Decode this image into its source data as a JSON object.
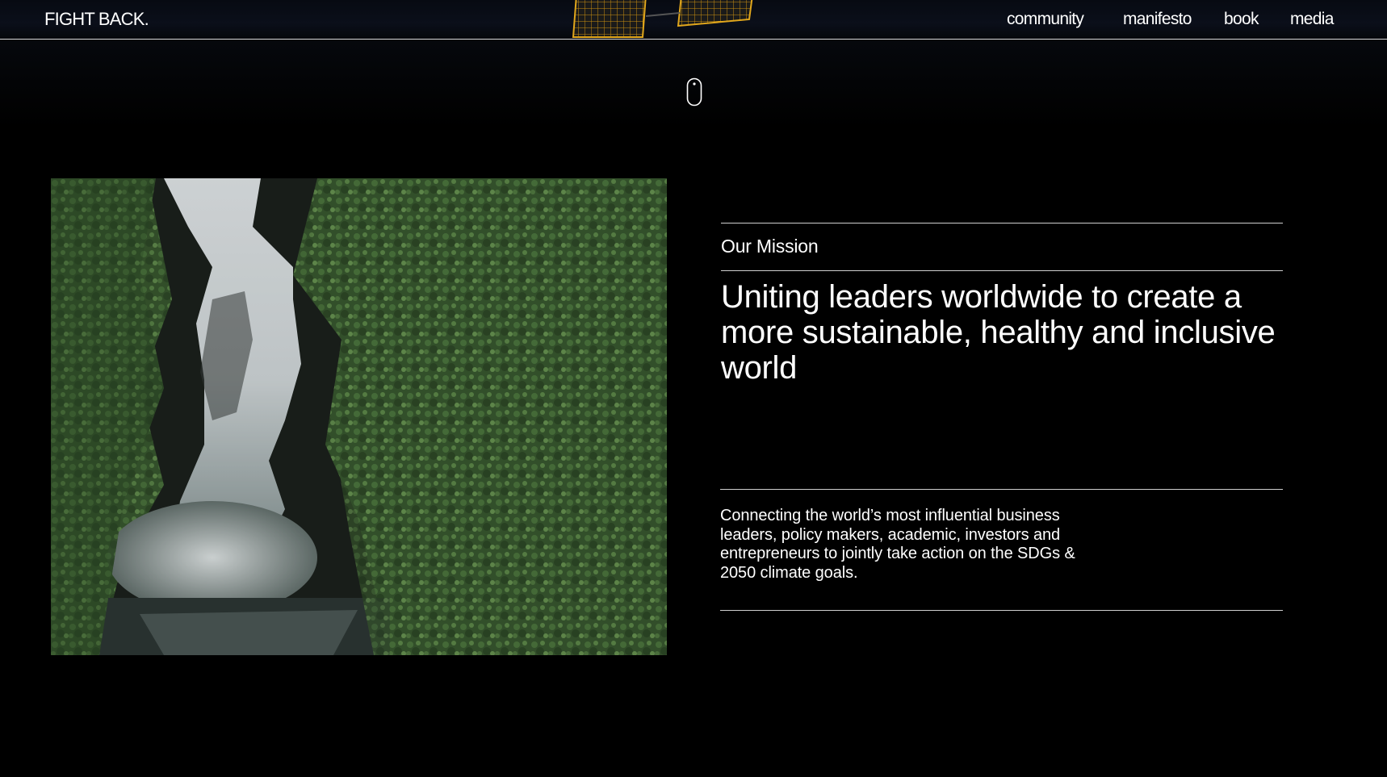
{
  "header": {
    "brand": "FIGHT BACK.",
    "nav": [
      {
        "label": "community"
      },
      {
        "label": "manifesto"
      },
      {
        "label": "book"
      },
      {
        "label": "media"
      }
    ]
  },
  "mission": {
    "label": "Our Mission",
    "headline": "Uniting leaders worldwide to create a more sustainable, healthy and inclusive world",
    "description": "Connecting the world’s most influential business leaders, policy makers, academic, investors and entrepreneurs to jointly take action on the SDGs & 2050 climate goals."
  },
  "colors": {
    "background": "#000000",
    "text": "#ffffff",
    "rule": "#cfcfcf",
    "satellite_panel": "#d9a21b"
  },
  "icons": {
    "scroll": "mouse-scroll-icon"
  }
}
